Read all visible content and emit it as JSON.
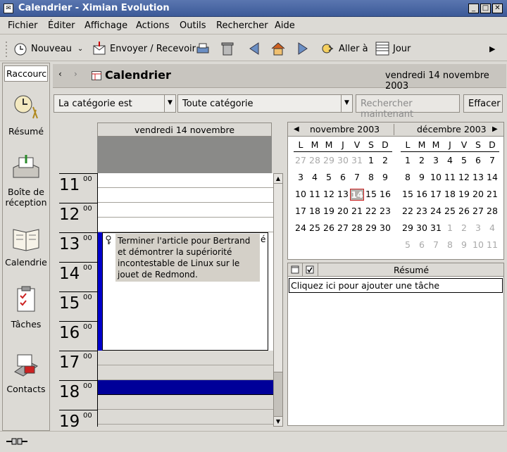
{
  "window": {
    "title": "Calendrier - Ximian Evolution",
    "app_icon": "evolution-icon"
  },
  "menu": [
    "Fichier",
    "Éditer",
    "Affichage",
    "Actions",
    "Outils",
    "Rechercher",
    "Aide"
  ],
  "toolbar": {
    "new_label": "Nouveau",
    "send_receive_label": "Envoyer / Recevoir",
    "goto_label": "Aller à",
    "day_label": "Jour"
  },
  "shortcuts": {
    "search_value": "Raccourci",
    "items": [
      "Résumé",
      "Boîte de réception",
      "Calendrie",
      "Tâches",
      "Contacts"
    ]
  },
  "header": {
    "title": "Calendrier",
    "date": "vendredi 14 novembre 2003"
  },
  "filter": {
    "field": "La catégorie est",
    "value": "Toute catégorie",
    "search_button": "Rechercher maintenant",
    "clear_button": "Effacer"
  },
  "dayview": {
    "date_label": "vendredi 14 novembre",
    "hours": [
      "11",
      "12",
      "13",
      "14",
      "15",
      "16",
      "17",
      "18",
      "19"
    ],
    "minutes": "00",
    "event_text": "Terminer l'article pour Bertrand et démontrer la supériorité incontestable de Linux sur le jouet de Redmond.",
    "event_overflow": "é"
  },
  "minicalendar": {
    "months": [
      "novembre 2003",
      "décembre 2003"
    ],
    "weekdays": [
      "L",
      "M",
      "M",
      "J",
      "V",
      "S",
      "D"
    ],
    "selected_day": "14",
    "nov": [
      [
        "27",
        "28",
        "29",
        "30",
        "31",
        "1",
        "2"
      ],
      [
        "3",
        "4",
        "5",
        "6",
        "7",
        "8",
        "9"
      ],
      [
        "10",
        "11",
        "12",
        "13",
        "14",
        "15",
        "16"
      ],
      [
        "17",
        "18",
        "19",
        "20",
        "21",
        "22",
        "23"
      ],
      [
        "24",
        "25",
        "26",
        "27",
        "28",
        "29",
        "30"
      ]
    ],
    "dec": [
      [
        "1",
        "2",
        "3",
        "4",
        "5",
        "6",
        "7"
      ],
      [
        "8",
        "9",
        "10",
        "11",
        "12",
        "13",
        "14"
      ],
      [
        "15",
        "16",
        "17",
        "18",
        "19",
        "20",
        "21"
      ],
      [
        "22",
        "23",
        "24",
        "25",
        "26",
        "27",
        "28"
      ],
      [
        "29",
        "30",
        "31",
        "1",
        "2",
        "3",
        "4"
      ],
      [
        "5",
        "6",
        "7",
        "8",
        "9",
        "10",
        "11"
      ]
    ]
  },
  "tasks": {
    "column": "Résumé",
    "placeholder": "Cliquez ici pour ajouter une tâche"
  },
  "colors": {
    "event_bar": "#0000cc",
    "busy_slot": "#000099",
    "selected_bg": "#d4d0c8"
  }
}
